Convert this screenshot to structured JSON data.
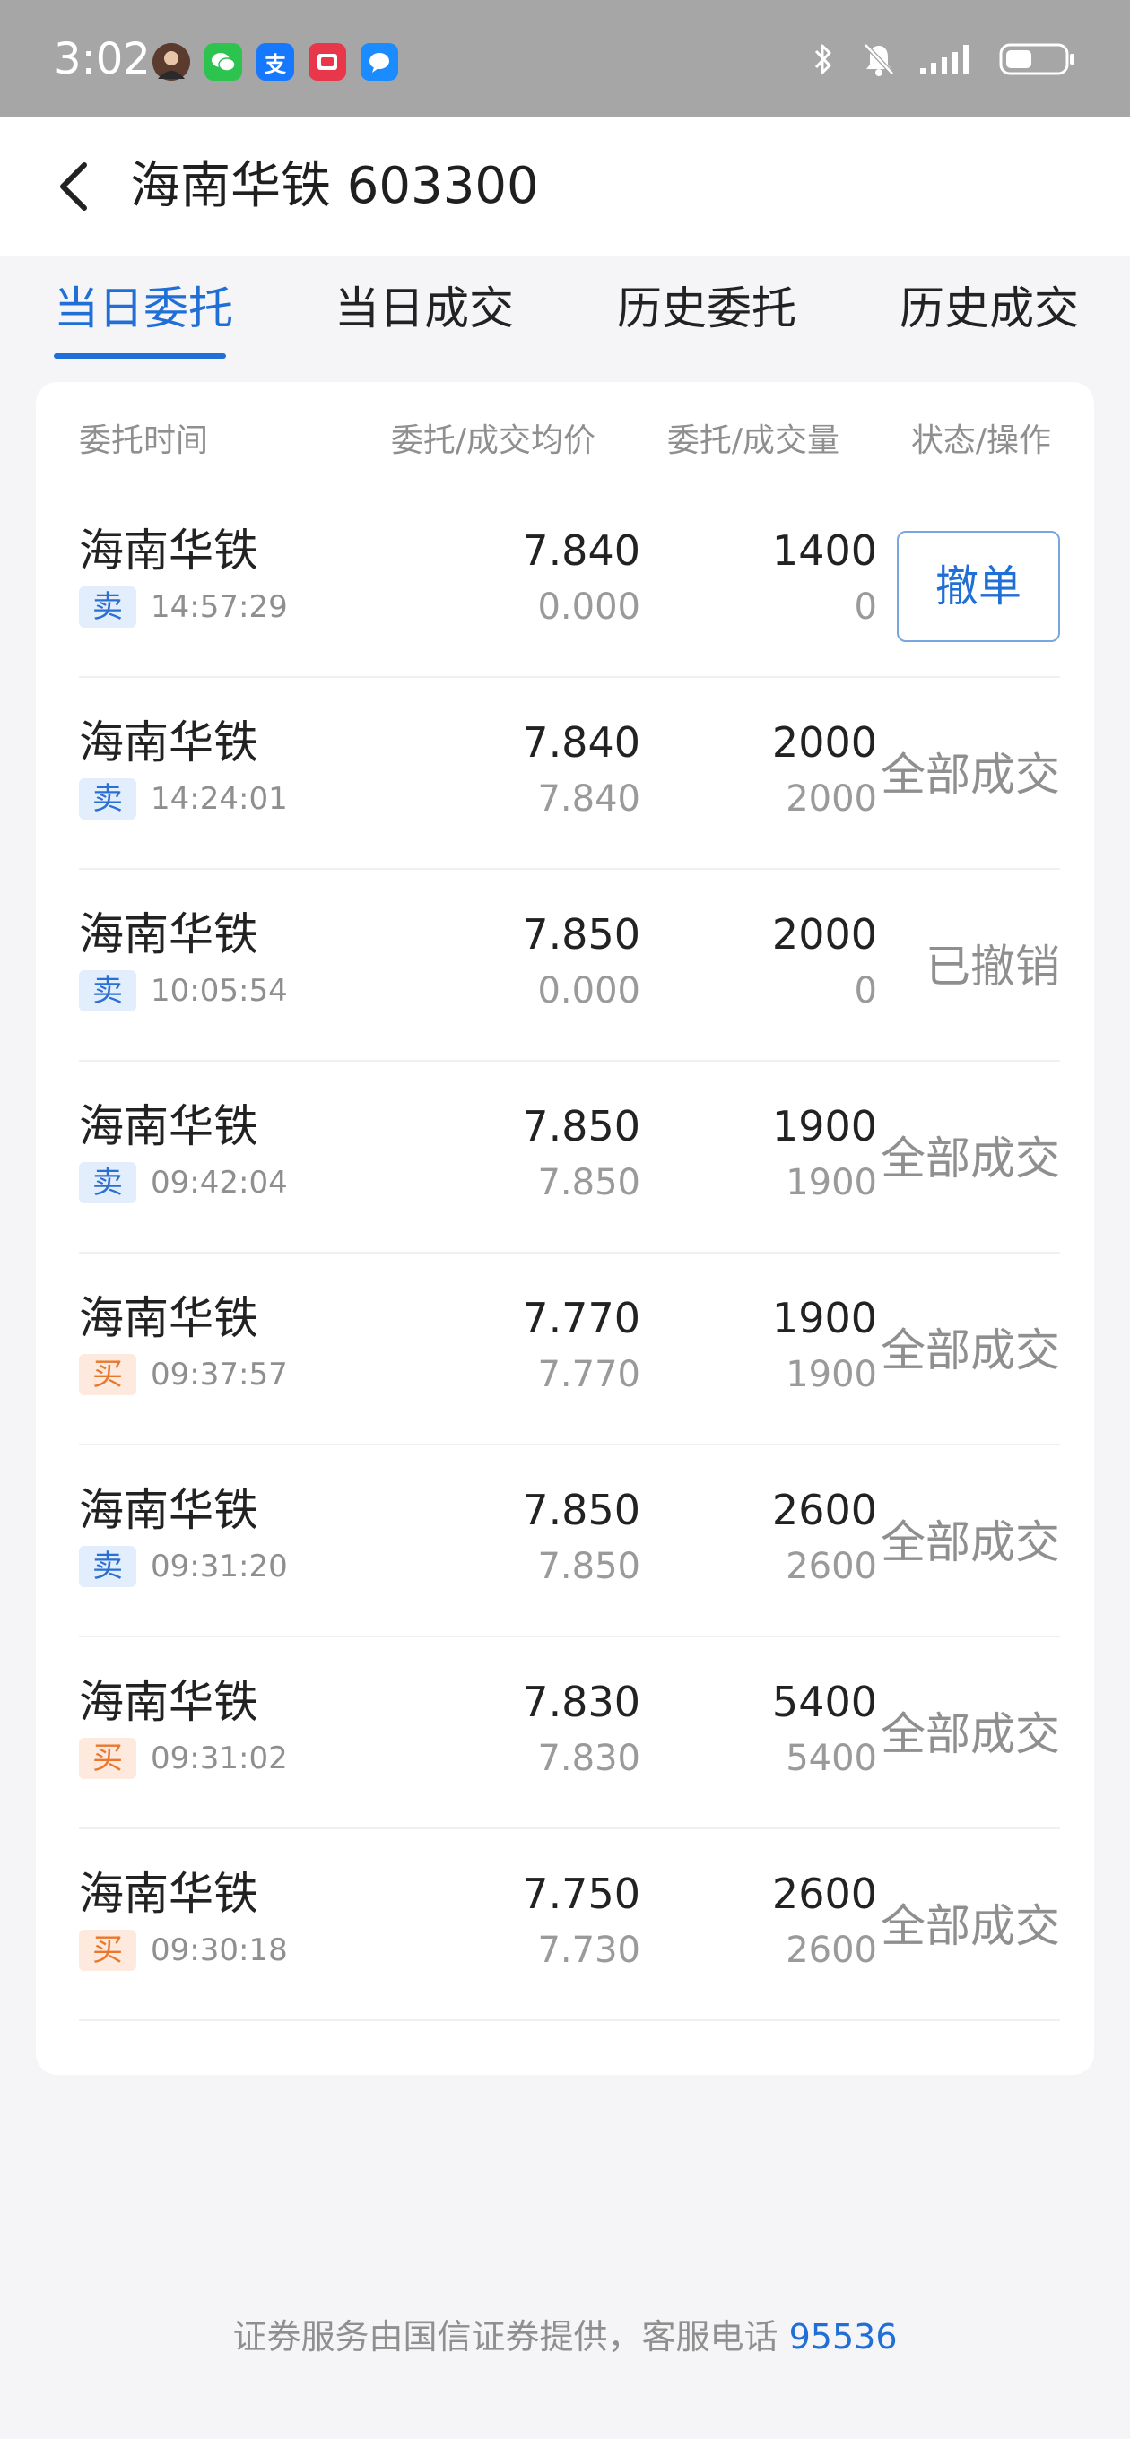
{
  "status_bar": {
    "time": "3:02",
    "app_icons": [
      "avatar-icon",
      "wechat-icon",
      "alipay-icon",
      "red-app-icon",
      "message-app-icon"
    ],
    "alipay_glyph": "支"
  },
  "header": {
    "title": "海南华铁 603300"
  },
  "tabs": [
    {
      "label": "当日委托",
      "active": true
    },
    {
      "label": "当日成交",
      "active": false
    },
    {
      "label": "历史委托",
      "active": false
    },
    {
      "label": "历史成交",
      "active": false
    }
  ],
  "table": {
    "headers": [
      "委托时间",
      "委托/成交均价",
      "委托/成交量",
      "状态/操作"
    ],
    "rows": [
      {
        "name": "海南华铁",
        "side": "卖",
        "side_type": "sell",
        "time": "14:57:29",
        "order_price": "7.840",
        "fill_price": "0.000",
        "order_qty": "1400",
        "fill_qty": "0",
        "status": "撤单",
        "action": true
      },
      {
        "name": "海南华铁",
        "side": "卖",
        "side_type": "sell",
        "time": "14:24:01",
        "order_price": "7.840",
        "fill_price": "7.840",
        "order_qty": "2000",
        "fill_qty": "2000",
        "status": "全部成交",
        "action": false
      },
      {
        "name": "海南华铁",
        "side": "卖",
        "side_type": "sell",
        "time": "10:05:54",
        "order_price": "7.850",
        "fill_price": "0.000",
        "order_qty": "2000",
        "fill_qty": "0",
        "status": "已撤销",
        "action": false
      },
      {
        "name": "海南华铁",
        "side": "卖",
        "side_type": "sell",
        "time": "09:42:04",
        "order_price": "7.850",
        "fill_price": "7.850",
        "order_qty": "1900",
        "fill_qty": "1900",
        "status": "全部成交",
        "action": false
      },
      {
        "name": "海南华铁",
        "side": "买",
        "side_type": "buy",
        "time": "09:37:57",
        "order_price": "7.770",
        "fill_price": "7.770",
        "order_qty": "1900",
        "fill_qty": "1900",
        "status": "全部成交",
        "action": false
      },
      {
        "name": "海南华铁",
        "side": "卖",
        "side_type": "sell",
        "time": "09:31:20",
        "order_price": "7.850",
        "fill_price": "7.850",
        "order_qty": "2600",
        "fill_qty": "2600",
        "status": "全部成交",
        "action": false
      },
      {
        "name": "海南华铁",
        "side": "买",
        "side_type": "buy",
        "time": "09:31:02",
        "order_price": "7.830",
        "fill_price": "7.830",
        "order_qty": "5400",
        "fill_qty": "5400",
        "status": "全部成交",
        "action": false
      },
      {
        "name": "海南华铁",
        "side": "买",
        "side_type": "buy",
        "time": "09:30:18",
        "order_price": "7.750",
        "fill_price": "7.730",
        "order_qty": "2600",
        "fill_qty": "2600",
        "status": "全部成交",
        "action": false
      }
    ]
  },
  "footer": {
    "text": "证券服务由国信证券提供，客服电话",
    "phone": "95536"
  },
  "colors": {
    "accent": "#1f6fd6",
    "sell_badge_bg": "#e3eefc",
    "sell_badge_text": "#2b6fd2",
    "buy_badge_bg": "#fde9dd",
    "buy_badge_text": "#e9782c",
    "status_bar_bg": "#a6a6a6",
    "page_bg": "#f5f5f7"
  }
}
